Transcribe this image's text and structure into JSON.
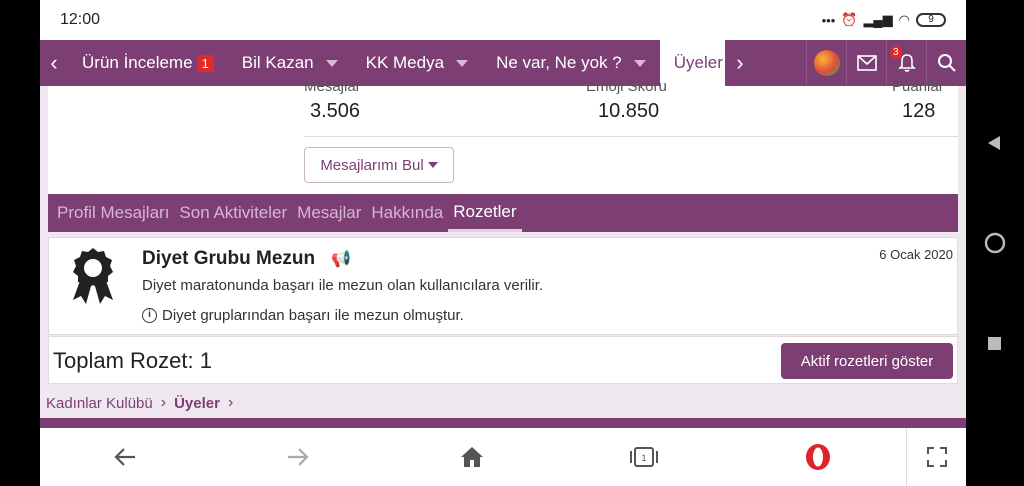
{
  "status_bar": {
    "time": "12:00",
    "dots": "•••",
    "battery": "9"
  },
  "nav": {
    "items": [
      {
        "label": "Ürün İnceleme",
        "badge": "1"
      },
      {
        "label": "Bil Kazan"
      },
      {
        "label": "KK Medya"
      },
      {
        "label": "Ne var, Ne yok ?"
      }
    ],
    "active_item": "Üyeler",
    "notification_count": "3"
  },
  "profile_stats": {
    "messages_label": "Mesajlar",
    "messages_value": "3.506",
    "emoji_label": "Emoji Skoru",
    "emoji_value": "10.850",
    "points_label": "Puanlar",
    "points_value": "128",
    "find_messages_label": "Mesajlarımı Bul"
  },
  "tabs": [
    "Profil Mesajları",
    "Son Aktiviteler",
    "Mesajlar",
    "Hakkında",
    "Rozetler"
  ],
  "badge": {
    "title": "Diyet Grubu Mezun",
    "date": "6 Ocak 2020",
    "description": "Diyet maratonunda başarı ile mezun olan kullanıcılara verilir.",
    "note": "Diyet gruplarından başarı ile mezun olmuştur."
  },
  "total": {
    "label": "Toplam Rozet: 1",
    "show_active_label": "Aktif rozetleri göster"
  },
  "breadcrumb": {
    "root": "Kadınlar Kulübü",
    "current": "Üyeler"
  },
  "colors": {
    "brand": "#7c3e73",
    "accent": "#e0292a"
  }
}
